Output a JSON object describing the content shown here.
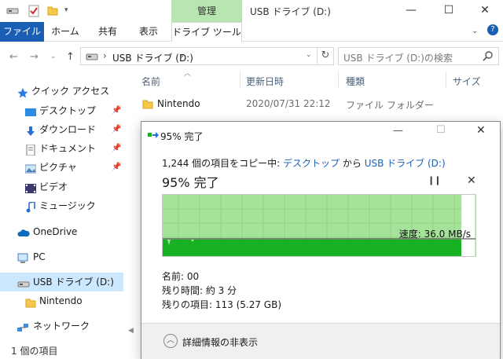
{
  "titlebar": {
    "context_tab": "管理",
    "title": "USB ドライブ (D:)"
  },
  "ribbon": {
    "tabs": [
      "ファイル",
      "ホーム",
      "共有",
      "表示",
      "ドライブ ツール"
    ]
  },
  "address": {
    "crumb_sep": "›",
    "location": "USB ドライブ (D:)",
    "search_placeholder": "USB ドライブ (D:)の検索"
  },
  "nav": {
    "quick_access": "クイック アクセス",
    "items": [
      {
        "label": "デスクトップ",
        "pinned": true
      },
      {
        "label": "ダウンロード",
        "pinned": true
      },
      {
        "label": "ドキュメント",
        "pinned": true
      },
      {
        "label": "ピクチャ",
        "pinned": true
      },
      {
        "label": "ビデオ"
      },
      {
        "label": "ミュージック"
      }
    ],
    "onedrive": "OneDrive",
    "pc": "PC",
    "usb": "USB ドライブ (D:)",
    "usb_child": "Nintendo",
    "network": "ネットワーク"
  },
  "columns": {
    "name": "名前",
    "date": "更新日時",
    "type": "種類",
    "size": "サイズ"
  },
  "files": [
    {
      "name": "Nintendo",
      "date": "2020/07/31 22:12",
      "type": "ファイル フォルダー"
    }
  ],
  "status": {
    "item_count": "1 個の項目"
  },
  "dialog": {
    "title": "95% 完了",
    "copy_count": "1,244 個の項目をコピー中:",
    "source": "デスクトップ",
    "from_word": "から",
    "dest": "USB ドライブ (D:)",
    "percent_label": "95% 完了",
    "progress": 0.95,
    "speed": "速度: 36.0 MB/s",
    "name_line": "名前: 00",
    "time_line": "残り時間: 約 3 分",
    "remaining_line": "残りの項目: 113 (5.27 GB)",
    "collapse_label": "詳細情報の非表示",
    "colors": {
      "progress_fill": "#a6e39a",
      "throughput_fill": "#17b123"
    }
  }
}
